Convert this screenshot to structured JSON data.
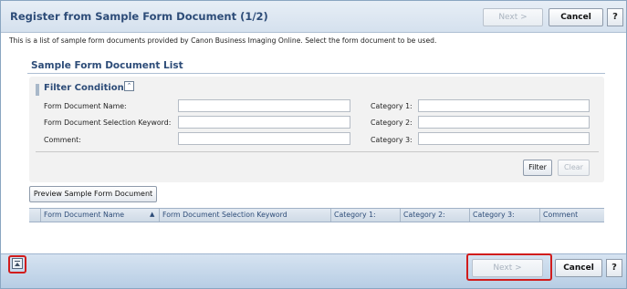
{
  "header": {
    "title": "Register from Sample Form Document (1/2)",
    "next_label": "Next >",
    "cancel_label": "Cancel",
    "help_label": "?"
  },
  "description": "This is a list of sample form documents provided by Canon Business Imaging Online. Select the form document to be used.",
  "list": {
    "title": "Sample Form Document List",
    "filter": {
      "title": "Filter Conditions",
      "collapse_icon": "chevron-double-up-icon",
      "fields": {
        "form_document_name": {
          "label": "Form Document Name:",
          "value": ""
        },
        "keyword": {
          "label": "Form Document Selection Keyword:",
          "value": ""
        },
        "comment": {
          "label": "Comment:",
          "value": ""
        },
        "category1": {
          "label": "Category 1:",
          "value": ""
        },
        "category2": {
          "label": "Category 2:",
          "value": ""
        },
        "category3": {
          "label": "Category 3:",
          "value": ""
        }
      },
      "filter_button": "Filter",
      "clear_button": "Clear"
    },
    "preview_button": "Preview Sample Form Document",
    "columns": [
      "Form Document Name",
      "Form Document Selection Keyword",
      "Category 1:",
      "Category 2:",
      "Category 3:",
      "Comment"
    ],
    "sort_indicator": "▲",
    "rows": []
  },
  "footer": {
    "next_label": "Next >",
    "cancel_label": "Cancel",
    "help_label": "?",
    "scroll_top_icon": "scroll-to-top-icon"
  },
  "colors": {
    "title_text": "#2d4c78",
    "highlight": "#d11c1c"
  }
}
